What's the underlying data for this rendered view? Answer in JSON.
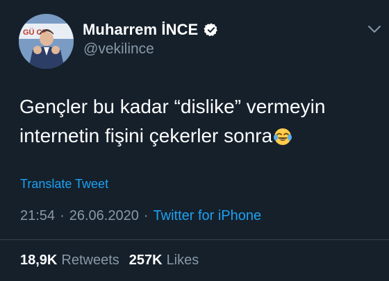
{
  "author": {
    "name": "Muharrem İNCE",
    "handle": "@vekilince",
    "avatar_banner_text": "GÜ CE",
    "verified": true
  },
  "tweet": {
    "lines": [
      "Gençler bu kadar “dislike” vermeyin",
      "internetin fişini çekerler sonra"
    ],
    "emoji": "face-with-tears-of-joy"
  },
  "translate_label": "Translate Tweet",
  "meta": {
    "time": "21:54",
    "separator": "·",
    "date": "26.06.2020",
    "source": "Twitter for iPhone"
  },
  "stats": {
    "retweets_count": "18,9K",
    "retweets_label": "Retweets",
    "likes_count": "257K",
    "likes_label": "Likes"
  },
  "colors": {
    "background": "#15202b",
    "text": "#ffffff",
    "secondary": "#8899a6",
    "link": "#1da1f2",
    "divider": "#38444d"
  }
}
